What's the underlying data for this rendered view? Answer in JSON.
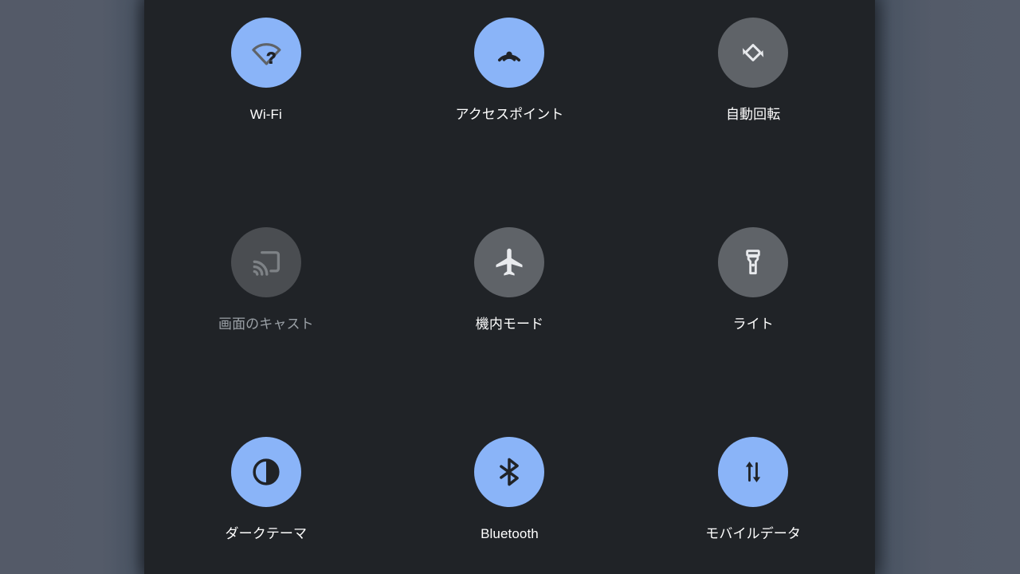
{
  "panel": {
    "name": "quick-settings-panel",
    "background_color": "#202327",
    "backdrop_color": "#535A69",
    "accent_on_color": "#8AB4F8",
    "accent_off_color": "#5F6368",
    "label_color": "#FFFFFF",
    "label_disabled_color": "#9AA0A6"
  },
  "tiles": [
    {
      "id": "wifi",
      "label": "Wi-Fi",
      "icon": "wifi-question-icon",
      "state": "on",
      "enabled": true
    },
    {
      "id": "hotspot",
      "label": "アクセスポイント",
      "icon": "hotspot-icon",
      "state": "on",
      "enabled": true
    },
    {
      "id": "auto-rotate",
      "label": "自動回転",
      "icon": "auto-rotate-icon",
      "state": "off",
      "enabled": true
    },
    {
      "id": "screen-cast",
      "label": "画面のキャスト",
      "icon": "cast-icon",
      "state": "disabled",
      "enabled": false
    },
    {
      "id": "airplane-mode",
      "label": "機内モード",
      "icon": "airplane-icon",
      "state": "off",
      "enabled": true
    },
    {
      "id": "flashlight",
      "label": "ライト",
      "icon": "flashlight-icon",
      "state": "off",
      "enabled": true
    },
    {
      "id": "dark-theme",
      "label": "ダークテーマ",
      "icon": "dark-theme-icon",
      "state": "on",
      "enabled": true
    },
    {
      "id": "bluetooth",
      "label": "Bluetooth",
      "icon": "bluetooth-icon",
      "state": "on",
      "enabled": true
    },
    {
      "id": "mobile-data",
      "label": "モバイルデータ",
      "icon": "mobile-data-icon",
      "state": "on",
      "enabled": true
    }
  ]
}
